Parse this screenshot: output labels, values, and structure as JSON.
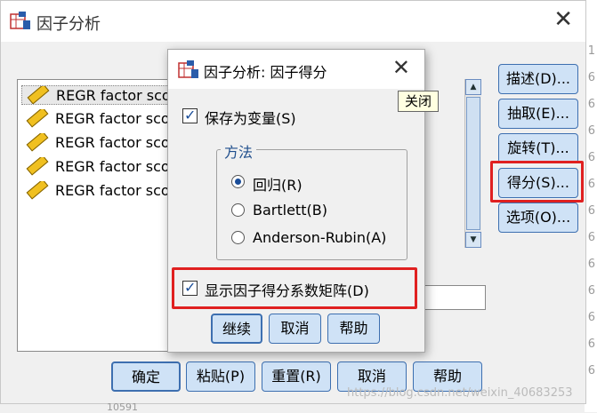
{
  "main_dialog": {
    "title": "因子分析",
    "variables": [
      "REGR factor sco",
      "REGR factor sco",
      "REGR factor sco",
      "REGR factor sco",
      "REGR factor sco"
    ],
    "side_buttons": {
      "describe": "描述(D)...",
      "extract": "抽取(E)...",
      "rotate": "旋转(T)...",
      "scores": "得分(S)...",
      "options": "选项(O)..."
    },
    "bottom_buttons": {
      "ok": "确定",
      "paste": "粘贴(P)",
      "reset": "重置(R)",
      "cancel": "取消",
      "help": "帮助"
    }
  },
  "scores_dialog": {
    "title": "因子分析: 因子得分",
    "close_tooltip": "关闭",
    "save_as_variables": "保存为变量(S)",
    "method_group_label": "方法",
    "methods": [
      "回归(R)",
      "Bartlett(B)",
      "Anderson-Rubin(A)"
    ],
    "selected_method": "回归(R)",
    "show_coef_matrix": "显示因子得分系数矩阵(D)",
    "buttons": {
      "continue": "继续",
      "cancel": "取消",
      "help": "帮助"
    }
  },
  "watermark": "https://blog.csdn.net/weixin_40683253",
  "background": {
    "right_digits": [
      "1",
      "6",
      "6",
      "6",
      "6",
      "6",
      "6",
      "6",
      "6",
      "6",
      "6",
      "6",
      "6"
    ],
    "bottom_cell": "10591"
  },
  "colors": {
    "button_bg": "#cfe2f6",
    "button_border": "#3d6fb0",
    "highlight_red": "#e02020"
  }
}
